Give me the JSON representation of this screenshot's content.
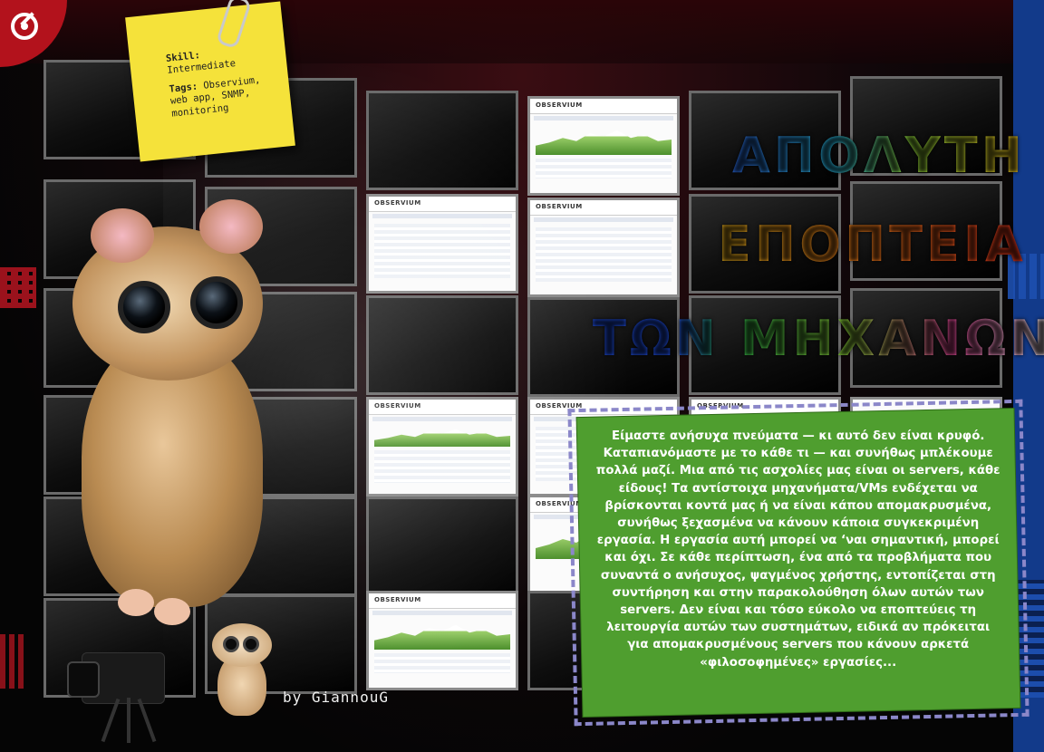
{
  "sticky_note": {
    "skill_label": "Skill:",
    "skill_value": "Intermediate",
    "tags_label": "Tags:",
    "tags_value": "Observium, web app, SNMP, monitoring"
  },
  "title": {
    "line1": "ΑΠΟΛΥΤΗ",
    "line2": "ΕΠΟΠΤΕΙΑ",
    "line3": "ΤΩΝ ΜΗΧΑΝΩΝ"
  },
  "screens": {
    "brand": "OBSERVIUM"
  },
  "intro": {
    "text": "Είμαστε ανήσυχα πνεύματα — κι αυτό δεν είναι κρυφό. Καταπιανόμαστε με το κάθε τι — και συνήθως μπλέκουμε πολλά μαζί. Μια από τις ασχολίες μας είναι οι servers, κάθε είδους! Τα αντίστοιχα μηχανήματα/VMs ενδέχεται να βρίσκονται κοντά μας ή να είναι κάπου απομακρυσμένα, συνήθως ξεχασμένα να κάνουν κάποια συγκεκριμένη εργασία. Η εργασία αυτή μπορεί να ‘ναι σημαντική, μπορεί και όχι. Σε κάθε περίπτωση, ένα από τα προβλήματα που συναντά ο ανήσυχος, ψαγμένος χρήστης, εντοπίζεται στη συντήρηση και στην παρακολούθηση όλων αυτών των servers. Δεν είναι και τόσο εύκολο να εποπτεύεις τη λειτουργία αυτών των συστημάτων, ειδικά αν πρόκειται για απομακρυσμένους servers που κάνουν αρκετά «φιλοσοφημένες» εργασίες..."
  },
  "byline": "by GiannouG",
  "colors": {
    "sticky": "#f5e23a",
    "intro_bg": "#4f9e2f",
    "corner_red": "#b3121c",
    "side_blue": "#123a8a"
  }
}
